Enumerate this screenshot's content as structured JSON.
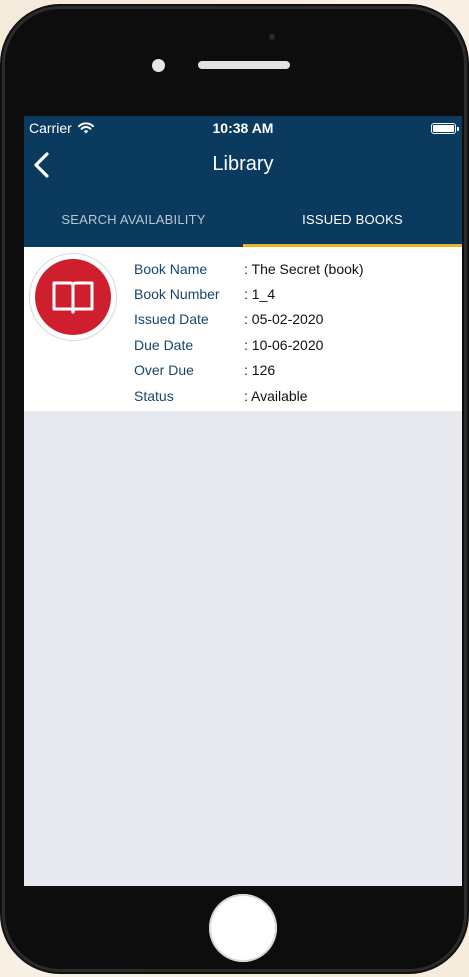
{
  "status_bar": {
    "carrier": "Carrier",
    "time": "10:38 AM"
  },
  "nav": {
    "title": "Library"
  },
  "tabs": [
    {
      "label": "SEARCH AVAILABILITY",
      "active": false
    },
    {
      "label": "ISSUED BOOKS",
      "active": true
    }
  ],
  "book": {
    "icon": "book-icon",
    "fields": [
      {
        "label": "Book Name",
        "value": ": The Secret (book)"
      },
      {
        "label": "Book Number",
        "value": ": 1_4"
      },
      {
        "label": "Issued Date",
        "value": ": 05-02-2020"
      },
      {
        "label": "Due Date",
        "value": ": 10-06-2020"
      },
      {
        "label": "Over Due",
        "value": ": 126"
      },
      {
        "label": "Status",
        "value": ": Available"
      }
    ]
  },
  "colors": {
    "header": "#0b3a5f",
    "tab_indicator": "#e7b521",
    "label_text": "#17466d",
    "book_icon_bg": "#cf1f2e",
    "screen_bg": "#e8e9ee"
  }
}
